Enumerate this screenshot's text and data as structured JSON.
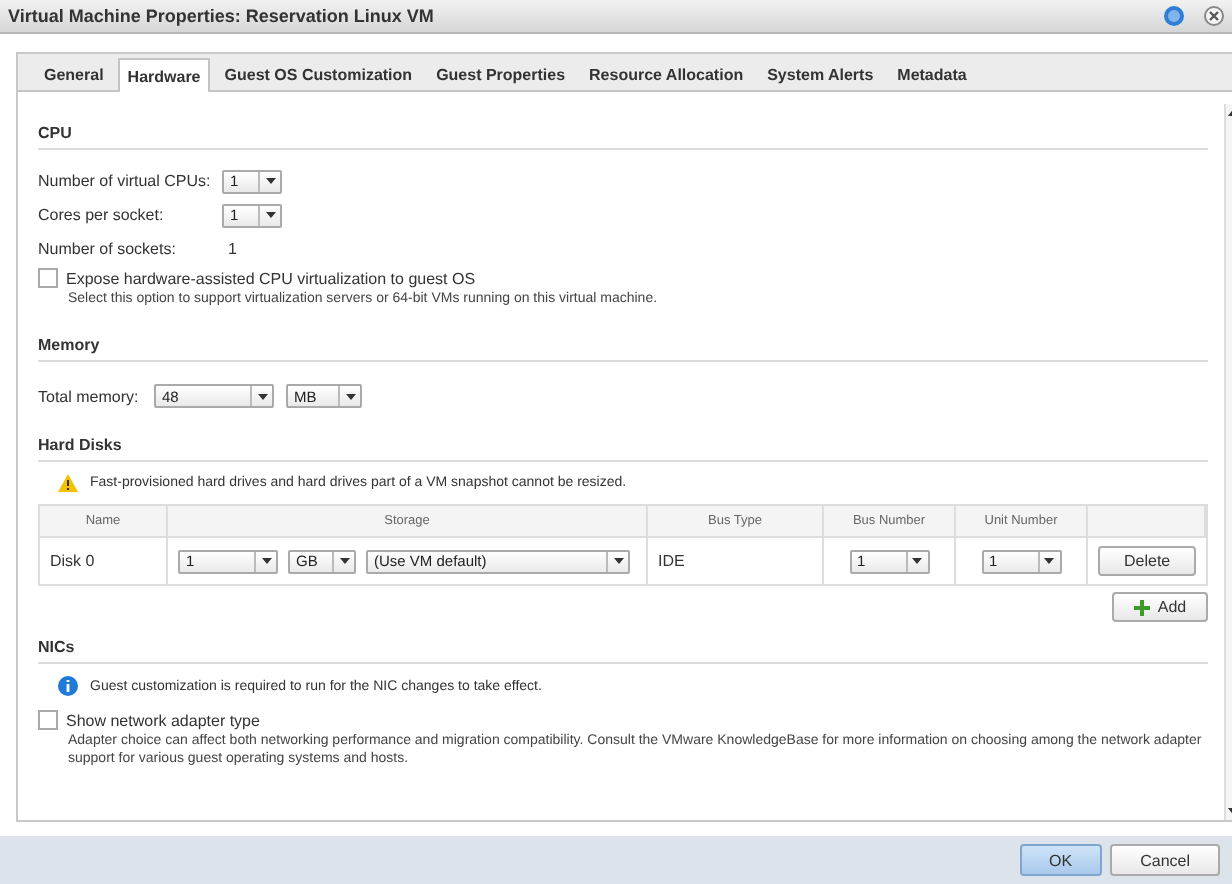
{
  "window": {
    "title": "Virtual Machine Properties: Reservation Linux VM"
  },
  "tabs": [
    {
      "label": "General",
      "selected": false
    },
    {
      "label": "Hardware",
      "selected": true
    },
    {
      "label": "Guest OS Customization",
      "selected": false
    },
    {
      "label": "Guest Properties",
      "selected": false
    },
    {
      "label": "Resource Allocation",
      "selected": false
    },
    {
      "label": "System Alerts",
      "selected": false
    },
    {
      "label": "Metadata",
      "selected": false
    }
  ],
  "cpu": {
    "heading": "CPU",
    "virtual_cpus": {
      "label": "Number of virtual CPUs:",
      "value": "1"
    },
    "cores_per_socket": {
      "label": "Cores per socket:",
      "value": "1"
    },
    "sockets": {
      "label": "Number of sockets:",
      "value": "1"
    },
    "expose_virtualization": {
      "label": "Expose hardware-assisted CPU virtualization to guest OS",
      "checked": false,
      "help": "Select this option to support virtualization servers or 64-bit VMs running on this virtual machine."
    }
  },
  "memory": {
    "heading": "Memory",
    "label": "Total memory:",
    "value": "48",
    "unit": "MB"
  },
  "hard_disks": {
    "heading": "Hard Disks",
    "warning": "Fast-provisioned hard drives and hard drives part of a VM snapshot cannot be resized.",
    "columns": [
      "Name",
      "Storage",
      "Bus Type",
      "Bus Number",
      "Unit Number"
    ],
    "rows": [
      {
        "name": "Disk 0",
        "size": "1",
        "unit": "GB",
        "policy": "(Use VM default)",
        "bus_type": "IDE",
        "bus_number": "1",
        "unit_number": "1",
        "action": "Delete"
      }
    ],
    "add": "Add"
  },
  "nics": {
    "heading": "NICs",
    "info": "Guest customization is required to run for the NIC changes to take effect.",
    "show_adapter_type": {
      "label": "Show network adapter type",
      "checked": false,
      "help": "Adapter choice can affect both networking performance and migration compatibility. Consult the VMware KnowledgeBase for more information on choosing among the network adapter support for various guest operating systems and hosts."
    }
  },
  "footer": {
    "buttons": [
      {
        "label": "OK",
        "kind": "primary"
      },
      {
        "label": "Cancel",
        "kind": "default"
      }
    ]
  }
}
